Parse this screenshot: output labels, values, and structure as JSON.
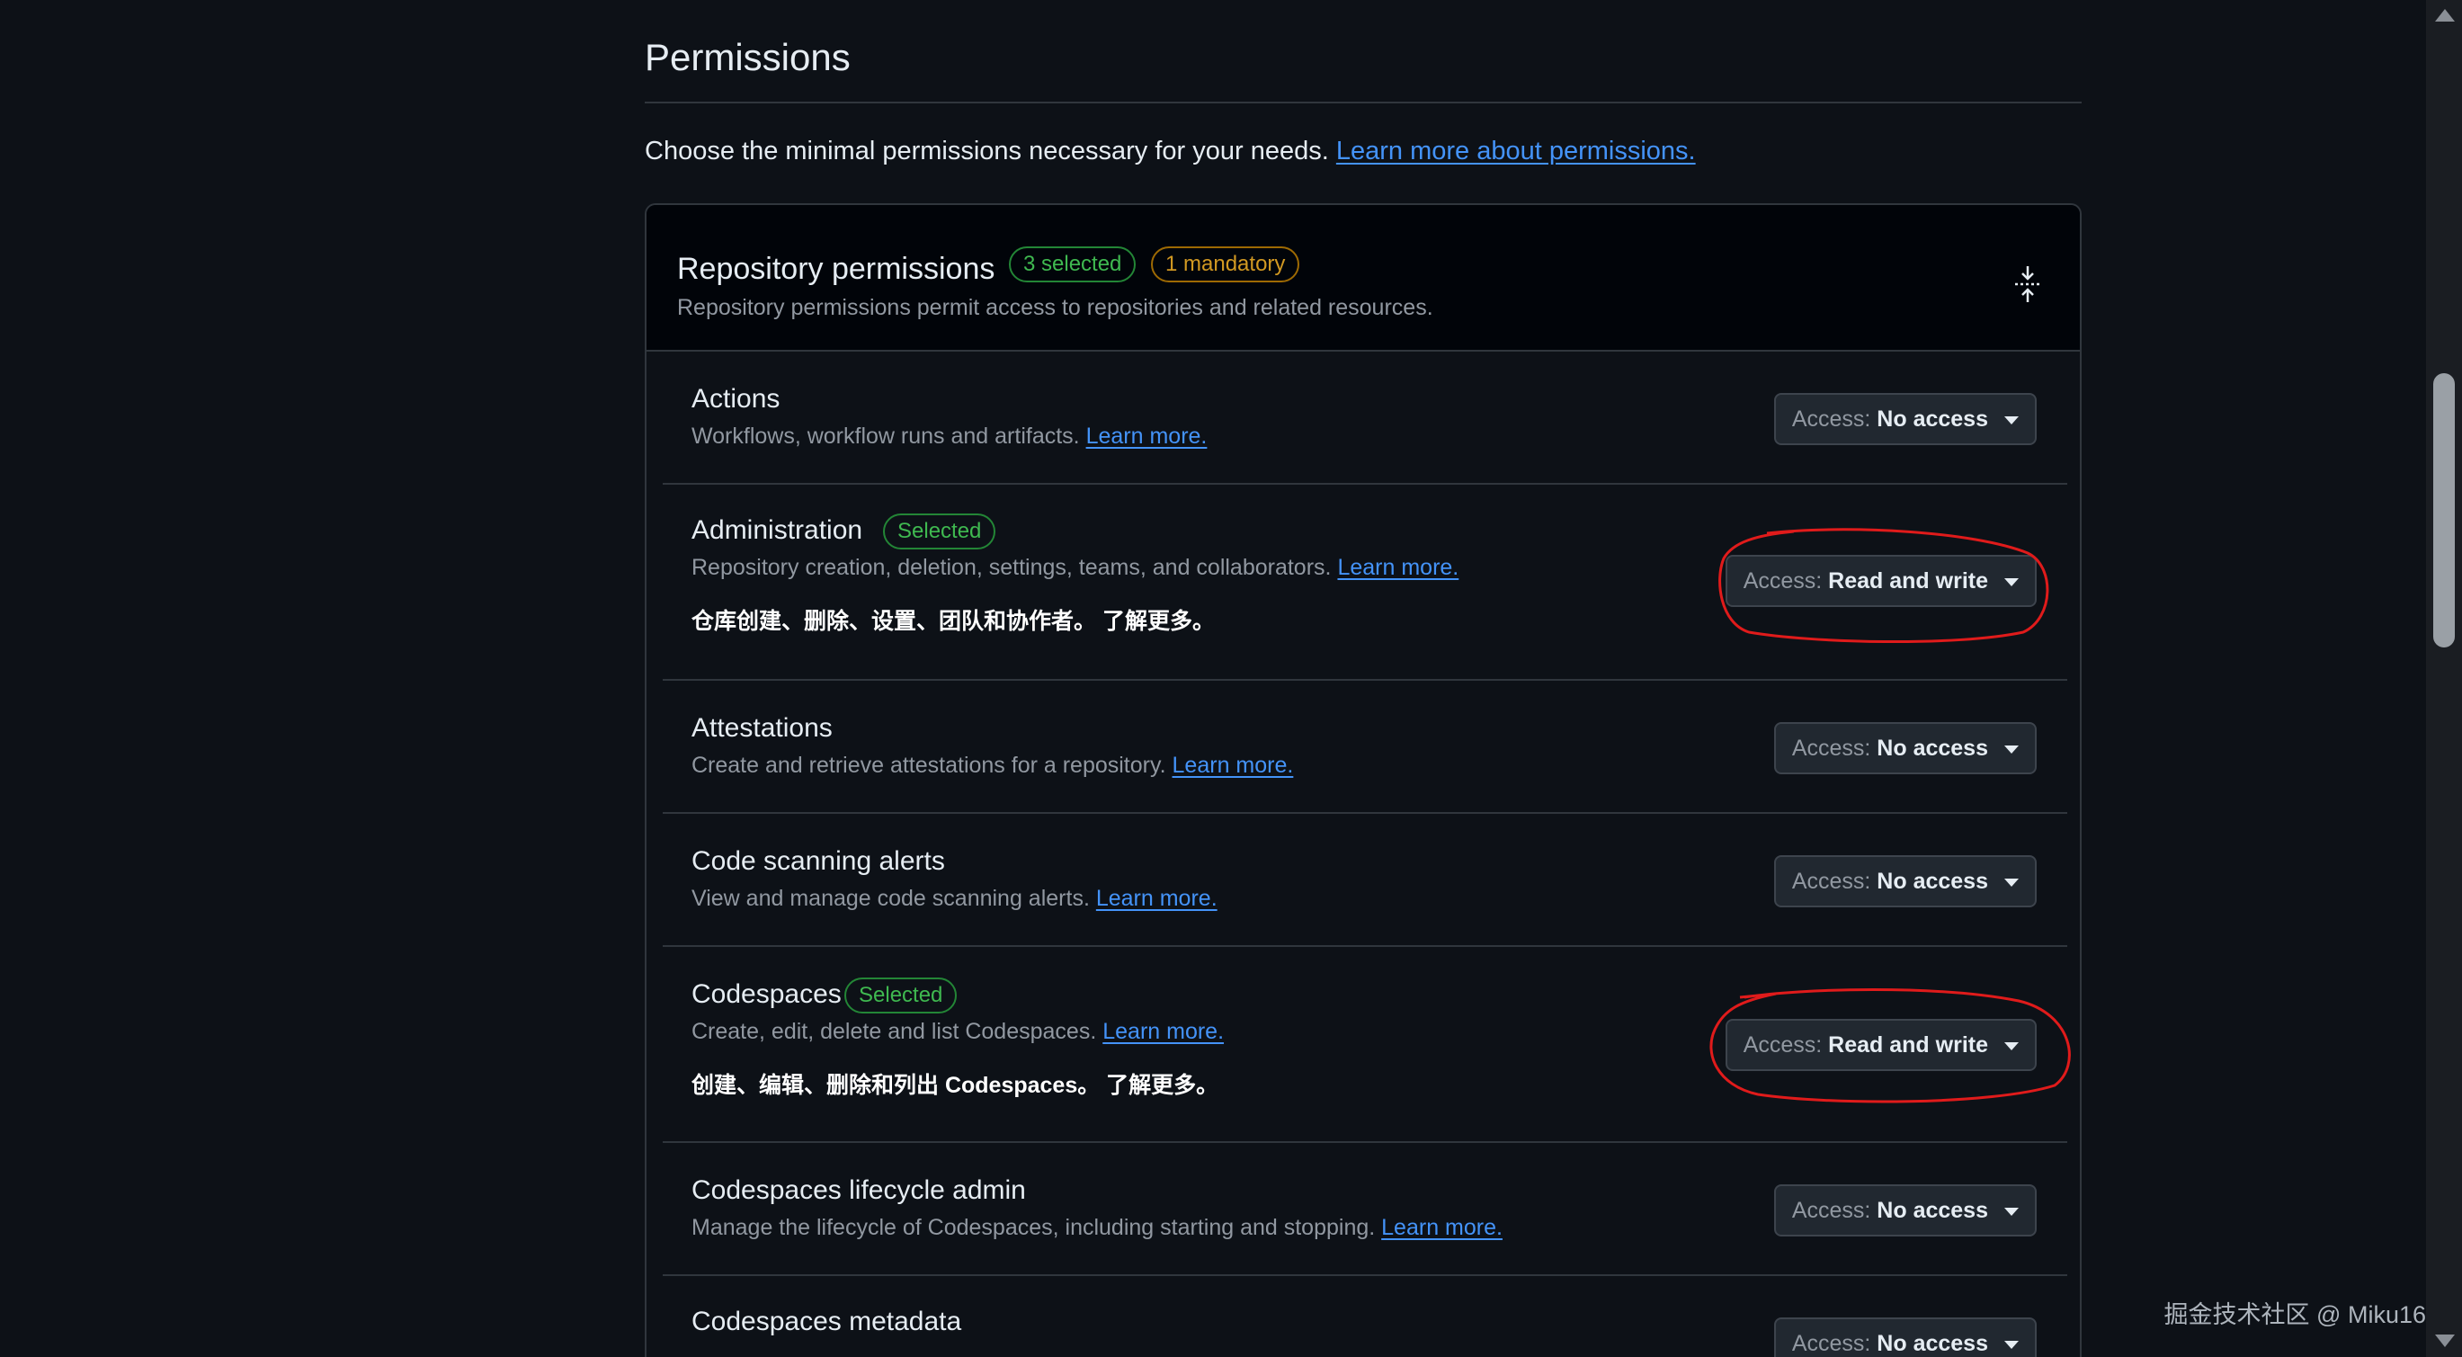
{
  "header": {
    "title": "Permissions",
    "intro_text": "Choose the minimal permissions necessary for your needs.",
    "intro_link": "Learn more about permissions."
  },
  "repo_permissions": {
    "title": "Repository permissions",
    "selected_badge": "3 selected",
    "mandatory_badge": "1 mandatory",
    "subtitle": "Repository permissions permit access to repositories and related resources.",
    "access_label": "Access:",
    "rows": [
      {
        "name": "Actions",
        "description": "Workflows, workflow runs and artifacts.",
        "link": "Learn more.",
        "access": "No access"
      },
      {
        "name": "Administration",
        "badge": "Selected",
        "description": "Repository creation, deletion, settings, teams, and collaborators.",
        "link": "Learn more.",
        "translation": "仓库创建、删除、设置、团队和协作者。 了解更多。",
        "access": "Read and write"
      },
      {
        "name": "Attestations",
        "description": "Create and retrieve attestations for a repository.",
        "link": "Learn more.",
        "access": "No access"
      },
      {
        "name": "Code scanning alerts",
        "description": "View and manage code scanning alerts.",
        "link": "Learn more.",
        "access": "No access"
      },
      {
        "name": "Codespaces",
        "badge": "Selected",
        "description": "Create, edit, delete and list Codespaces.",
        "link": "Learn more.",
        "translation": "创建、编辑、删除和列出 Codespaces。 了解更多。",
        "access": "Read and write"
      },
      {
        "name": "Codespaces lifecycle admin",
        "description": "Manage the lifecycle of Codespaces, including starting and stopping.",
        "link": "Learn more.",
        "access": "No access"
      },
      {
        "name": "Codespaces metadata",
        "description": "",
        "link": "",
        "access": "No access"
      }
    ]
  },
  "watermark": "掘金技术社区 @ Miku16",
  "colors": {
    "background": "#0d1117",
    "header_bg": "#010409",
    "border": "#30363d",
    "link": "#4493f8",
    "green": "#3fb950",
    "orange": "#d29922",
    "annotation": "#e01b1b"
  }
}
